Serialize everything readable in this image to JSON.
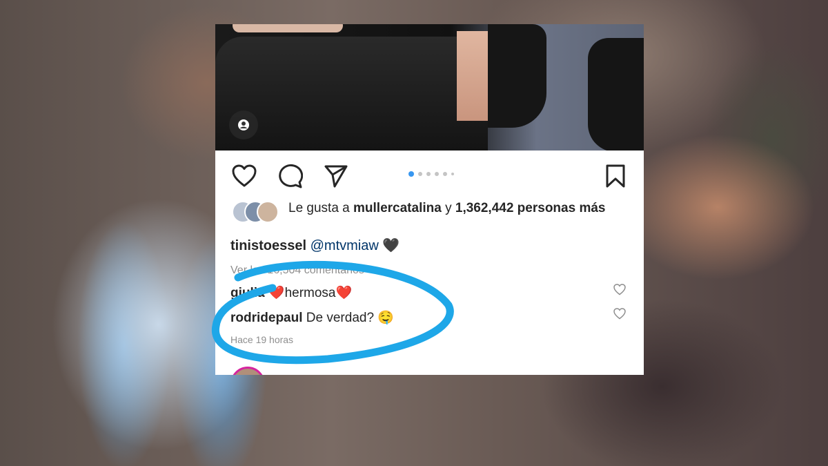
{
  "post": {
    "likes_prefix": "Le gusta a",
    "liked_by_user": "mullercatalina",
    "likes_joiner": "y",
    "likes_count": "1,362,442 personas más",
    "caption_user": "tinistoessel",
    "caption_mention": "@mtvmiaw",
    "caption_emoji": "🖤",
    "view_all_comments": "Ver los 16,504 comentarios",
    "time_ago": "Hace 19 horas",
    "carousel_total": 6,
    "carousel_active": 1
  },
  "comments": [
    {
      "user": "giulia",
      "text": "❤️hermosa❤️"
    },
    {
      "user": "rodridepaul",
      "text": "De verdad? 🤤"
    }
  ],
  "colors": {
    "accent": "#3897f0",
    "highlight_ring": "#1ea7e8",
    "text": "#262626",
    "muted": "#8e8e8e"
  },
  "icons": {
    "like": "heart-icon",
    "comment": "comment-bubble-icon",
    "share": "paper-plane-icon",
    "save": "bookmark-icon",
    "tag": "user-tag-icon"
  }
}
